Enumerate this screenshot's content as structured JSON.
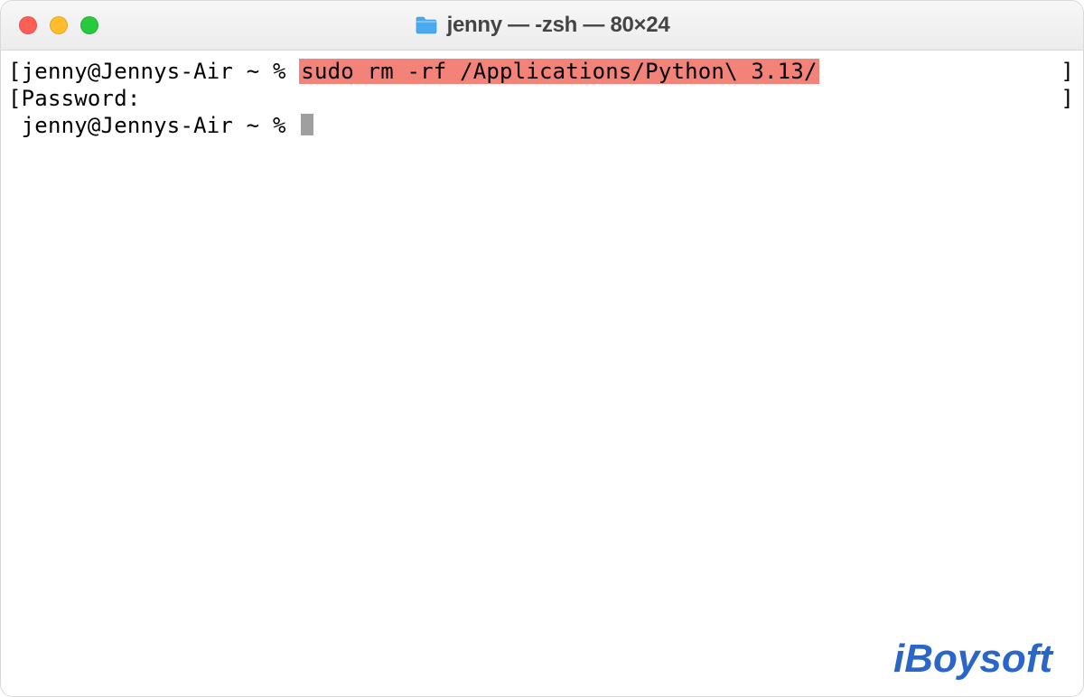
{
  "titlebar": {
    "title": "jenny — -zsh — 80×24"
  },
  "terminal": {
    "line1_prompt_prefix": "[",
    "line1_prompt": "jenny@Jennys-Air ~ % ",
    "line1_command": "sudo rm -rf /Applications/Python\\ 3.13/",
    "line2_prefix": "[",
    "line2_text": "Password:",
    "line3_prompt": " jenny@Jennys-Air ~ % ",
    "right_bracket": "]"
  },
  "watermark": {
    "text": "iBoysoft"
  },
  "colors": {
    "highlight": "#f38279",
    "brand": "#2a66c7"
  }
}
